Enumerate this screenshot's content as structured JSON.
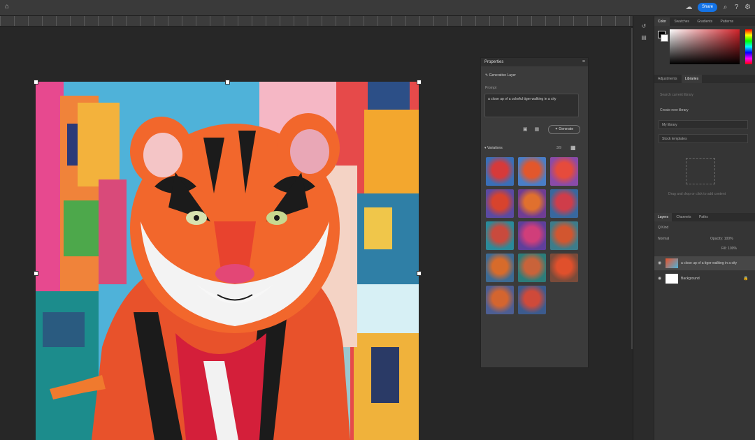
{
  "topbar": {
    "share_label": "Share",
    "icons": [
      "home-icon",
      "cloud-icon",
      "search-icon",
      "help-icon",
      "settings-icon",
      "account-icon"
    ]
  },
  "ruler": {
    "ticks": [
      "0",
      "50",
      "100",
      "150",
      "200",
      "250",
      "300",
      "350",
      "400",
      "450",
      "500",
      "550",
      "600",
      "650",
      "700",
      "750",
      "800",
      "850",
      "900"
    ]
  },
  "properties": {
    "title": "Properties",
    "layer_type": "Generative Layer",
    "prompt_label": "Prompt",
    "prompt_text": "a close up of a colorful tiger walking in a city",
    "generate_label": "Generate",
    "variations_label": "Variations",
    "variations_count": "3/9",
    "thumbnails": [
      {
        "c1": "#3a6fb8",
        "c2": "#d63a3a"
      },
      {
        "c1": "#4a7ec7",
        "c2": "#e2572c"
      },
      {
        "c1": "#8a4ba8",
        "c2": "#e64b3c"
      },
      {
        "c1": "#5b4aa2",
        "c2": "#d8432d"
      },
      {
        "c1": "#6f3d94",
        "c2": "#e0702e"
      },
      {
        "c1": "#38689f",
        "c2": "#cf3d4a"
      },
      {
        "c1": "#2b8a9a",
        "c2": "#c94a3d"
      },
      {
        "c1": "#5f3f9b",
        "c2": "#d03e7a"
      },
      {
        "c1": "#3d7c8a",
        "c2": "#d2562f"
      },
      {
        "c1": "#3d6b94",
        "c2": "#d76b2b"
      },
      {
        "c1": "#2c7d7a",
        "c2": "#c9633a"
      },
      {
        "c1": "#7a4b3a",
        "c2": "#e0502c"
      },
      {
        "c1": "#4d5e93",
        "c2": "#d4652f"
      },
      {
        "c1": "#3c5b8e",
        "c2": "#cf4a3a"
      }
    ]
  },
  "right": {
    "color_tabs": [
      "Color",
      "Swatches",
      "Gradients",
      "Patterns"
    ],
    "lib_tabs": [
      "Adjustments",
      "Libraries"
    ],
    "lib_search": "Search current library",
    "create_new_library": "Create new library",
    "my_library": "My library",
    "stock_templates": "Stock templates",
    "lib_hint": "Drag and drop or click to add content",
    "layers_tabs": [
      "Layers",
      "Channels",
      "Paths"
    ],
    "kind_label": "Q Kind",
    "blend_mode": "Normal",
    "opacity": "Opacity: 100%",
    "fill": "Fill: 100%",
    "layers": [
      {
        "name": "a close up of a tiger walking in a city",
        "selected": true
      },
      {
        "name": "Background",
        "selected": false
      }
    ]
  }
}
